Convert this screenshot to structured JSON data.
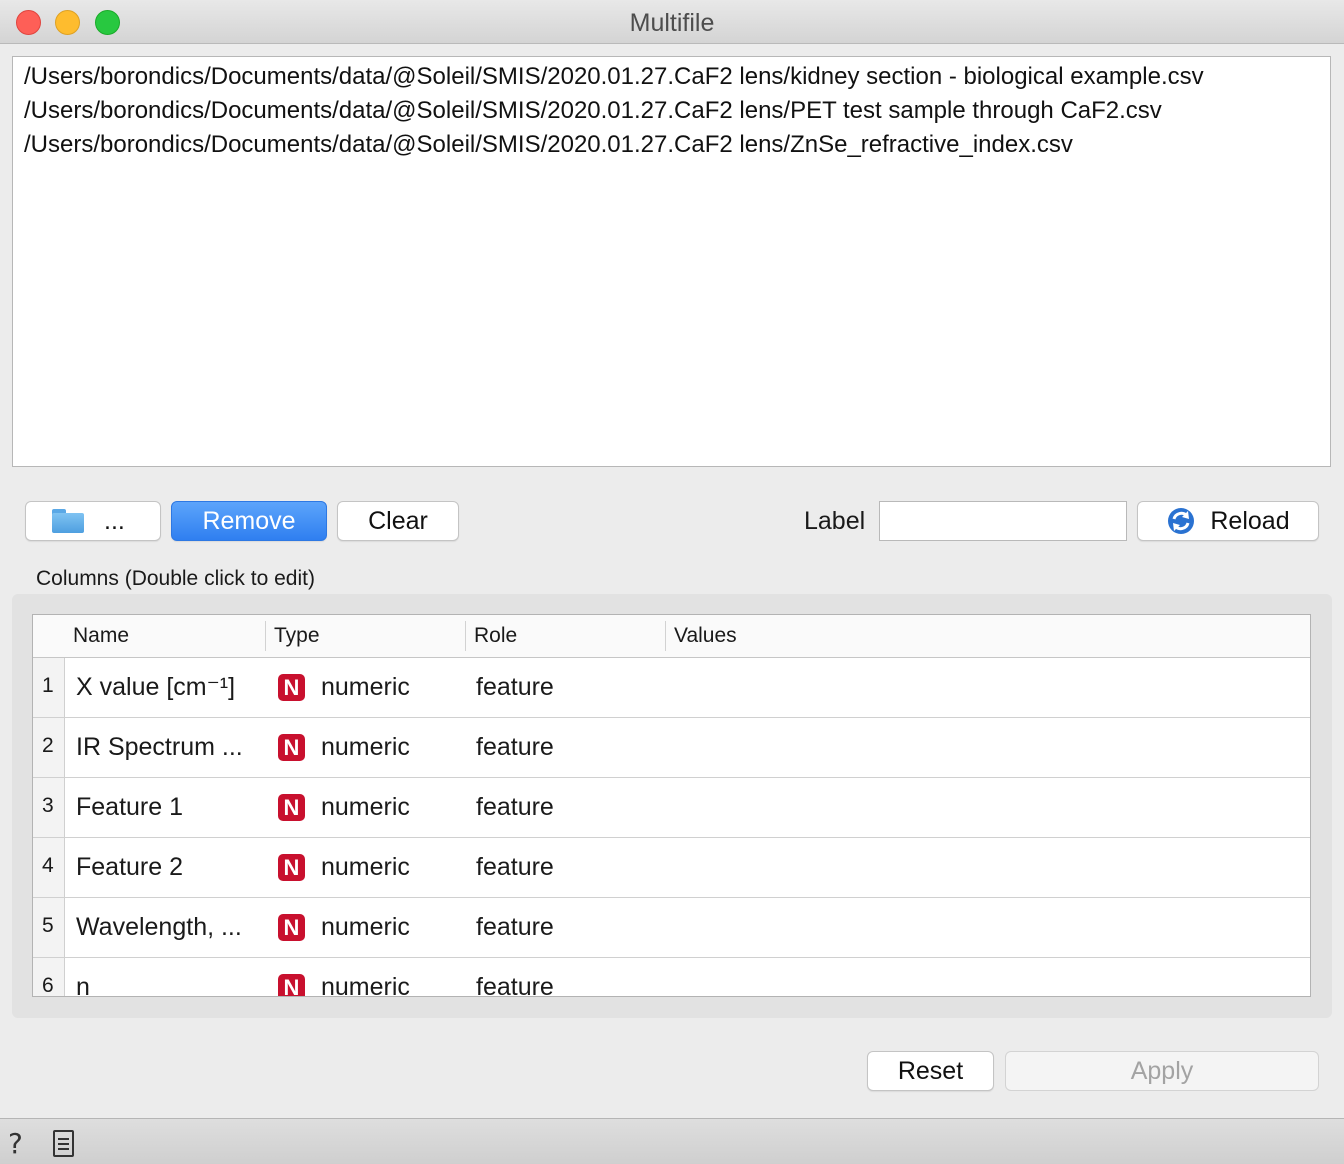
{
  "window": {
    "title": "Multifile"
  },
  "file_list": [
    "/Users/borondics/Documents/data/@Soleil/SMIS/2020.01.27.CaF2 lens/kidney section - biological example.csv",
    "/Users/borondics/Documents/data/@Soleil/SMIS/2020.01.27.CaF2 lens/PET test sample through CaF2.csv",
    "/Users/borondics/Documents/data/@Soleil/SMIS/2020.01.27.CaF2 lens/ZnSe_refractive_index.csv"
  ],
  "toolbar": {
    "browse_icon": "folder-icon",
    "browse_label": "...",
    "remove_label": "Remove",
    "clear_label": "Clear",
    "label_text": "Label",
    "label_value": "",
    "reload_icon": "reload-icon",
    "reload_label": "Reload"
  },
  "columns": {
    "caption": "Columns (Double click to edit)",
    "headers": {
      "name": "Name",
      "type": "Type",
      "role": "Role",
      "values": "Values"
    },
    "rows": [
      {
        "index": "1",
        "name": "X value [cm⁻¹]",
        "type_badge": "N",
        "type": "numeric",
        "role": "feature",
        "values": ""
      },
      {
        "index": "2",
        "name": "IR Spectrum ...",
        "type_badge": "N",
        "type": "numeric",
        "role": "feature",
        "values": ""
      },
      {
        "index": "3",
        "name": "Feature 1",
        "type_badge": "N",
        "type": "numeric",
        "role": "feature",
        "values": ""
      },
      {
        "index": "4",
        "name": "Feature 2",
        "type_badge": "N",
        "type": "numeric",
        "role": "feature",
        "values": ""
      },
      {
        "index": "5",
        "name": "Wavelength, ...",
        "type_badge": "N",
        "type": "numeric",
        "role": "feature",
        "values": ""
      },
      {
        "index": "6",
        "name": "n",
        "type_badge": "N",
        "type": "numeric",
        "role": "feature",
        "values": ""
      }
    ]
  },
  "footer": {
    "reset_label": "Reset",
    "apply_label": "Apply",
    "apply_enabled": false
  },
  "statusbar": {
    "help_icon": "help-icon",
    "report_icon": "document-icon"
  },
  "colors": {
    "accent": "#3b8cf5",
    "numeric_badge": "#c8102e",
    "disabled_text": "#a3a3a3"
  }
}
